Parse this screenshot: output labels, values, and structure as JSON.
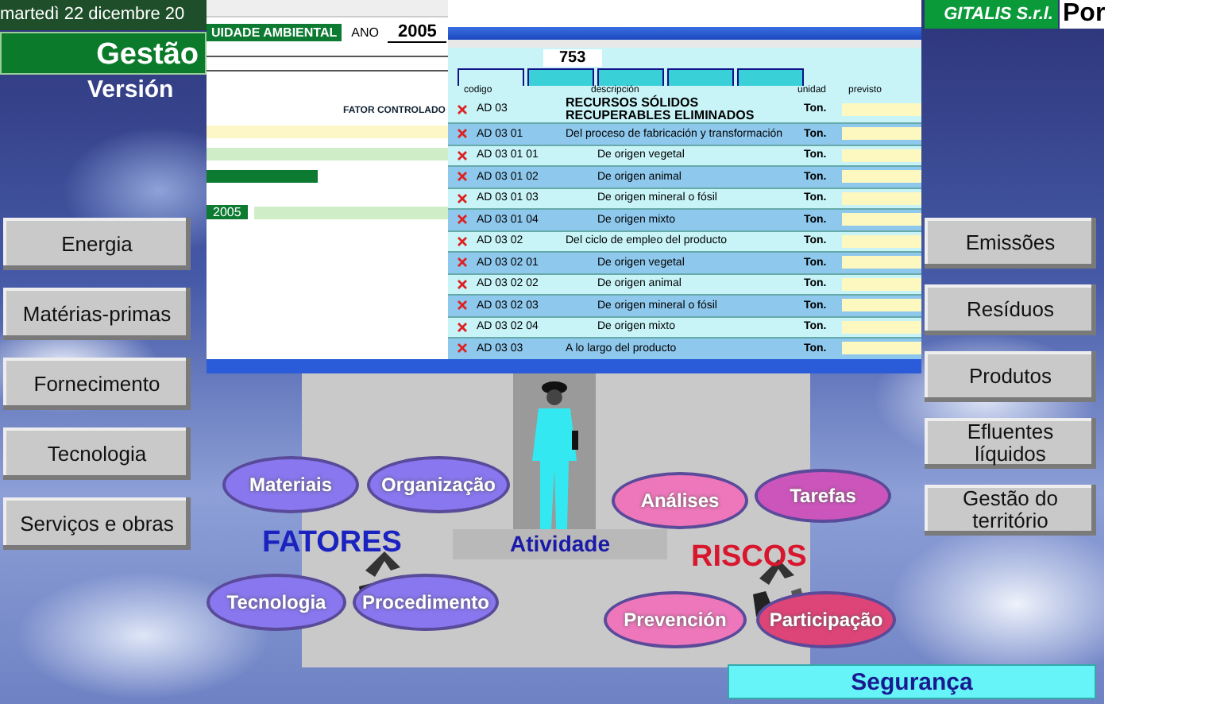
{
  "date": "martedì 22 dicembre 20",
  "title": "Gestão",
  "subtitle": "Versión",
  "company": "GITALIS S.r.l.",
  "company_suffix": "Por",
  "left_buttons": [
    "Energia",
    "Matérias-primas",
    "Fornecimento",
    "Tecnologia",
    "Serviços e obras"
  ],
  "right_buttons": [
    "Emissões",
    "Resíduos",
    "Produtos",
    "Efluentes líquidos",
    "Gestão do território"
  ],
  "doc_window": {
    "heading": "UIDADE AMBIENTAL",
    "year_label": "ANO",
    "year": "2005",
    "factor_label": "FATOR CONTROLADO",
    "year_cell": "2005"
  },
  "table_window": {
    "number": "753",
    "tabs": [
      {
        "selected": true
      },
      {
        "selected": false
      },
      {
        "selected": false
      },
      {
        "selected": false
      },
      {
        "selected": false
      }
    ],
    "columns": [
      "codigo",
      "descripción",
      "unidad",
      "previsto"
    ],
    "rows": [
      {
        "code": "AD 03",
        "description": "RECURSOS SÓLIDOS RECUPERABLES ELIMINADOS",
        "unit": "Ton.",
        "children": [
          {
            "code": "AD 03 01",
            "description": "Del proceso de fabricación y transformación",
            "unit": "Ton.",
            "children": [
              {
                "code": "AD 03 01 01",
                "description": "De origen vegetal",
                "unit": "Ton."
              },
              {
                "code": "AD 03 01 02",
                "description": "De origen animal",
                "unit": "Ton."
              },
              {
                "code": "AD 03 01 03",
                "description": "De origen mineral o fósil",
                "unit": "Ton."
              },
              {
                "code": "AD 03 01 04",
                "description": "De origen mixto",
                "unit": "Ton."
              }
            ]
          },
          {
            "code": "AD 03 02",
            "description": "Del ciclo de empleo del producto",
            "unit": "Ton.",
            "children": [
              {
                "code": "AD 03 02 01",
                "description": "De origen vegetal",
                "unit": "Ton."
              },
              {
                "code": "AD 03 02 02",
                "description": "De origen animal",
                "unit": "Ton."
              },
              {
                "code": "AD 03 02 03",
                "description": "De origen mineral o fósil",
                "unit": "Ton."
              },
              {
                "code": "AD 03 02 04",
                "description": "De origen mixto",
                "unit": "Ton."
              }
            ]
          },
          {
            "code": "AD 03 03",
            "description": "A lo largo del producto",
            "unit": "Ton."
          }
        ]
      }
    ]
  },
  "factors_label": "FATORES",
  "activity_label": "Atividade",
  "risks_label": "RISCOS",
  "factors": [
    {
      "label": "Materiais",
      "color": "#8877ee"
    },
    {
      "label": "Organização",
      "color": "#8877ee"
    },
    {
      "label": "Tecnologia",
      "color": "#8877ee"
    },
    {
      "label": "Procedimento",
      "color": "#8877ee"
    }
  ],
  "risks": [
    {
      "label": "Análises",
      "color": "#ee77bb"
    },
    {
      "label": "Tarefas",
      "color": "#cc55bb"
    },
    {
      "label": "Prevención",
      "color": "#ee77bb"
    },
    {
      "label": "Participação",
      "color": "#dd4477"
    }
  ],
  "footer_button": "Segurança"
}
